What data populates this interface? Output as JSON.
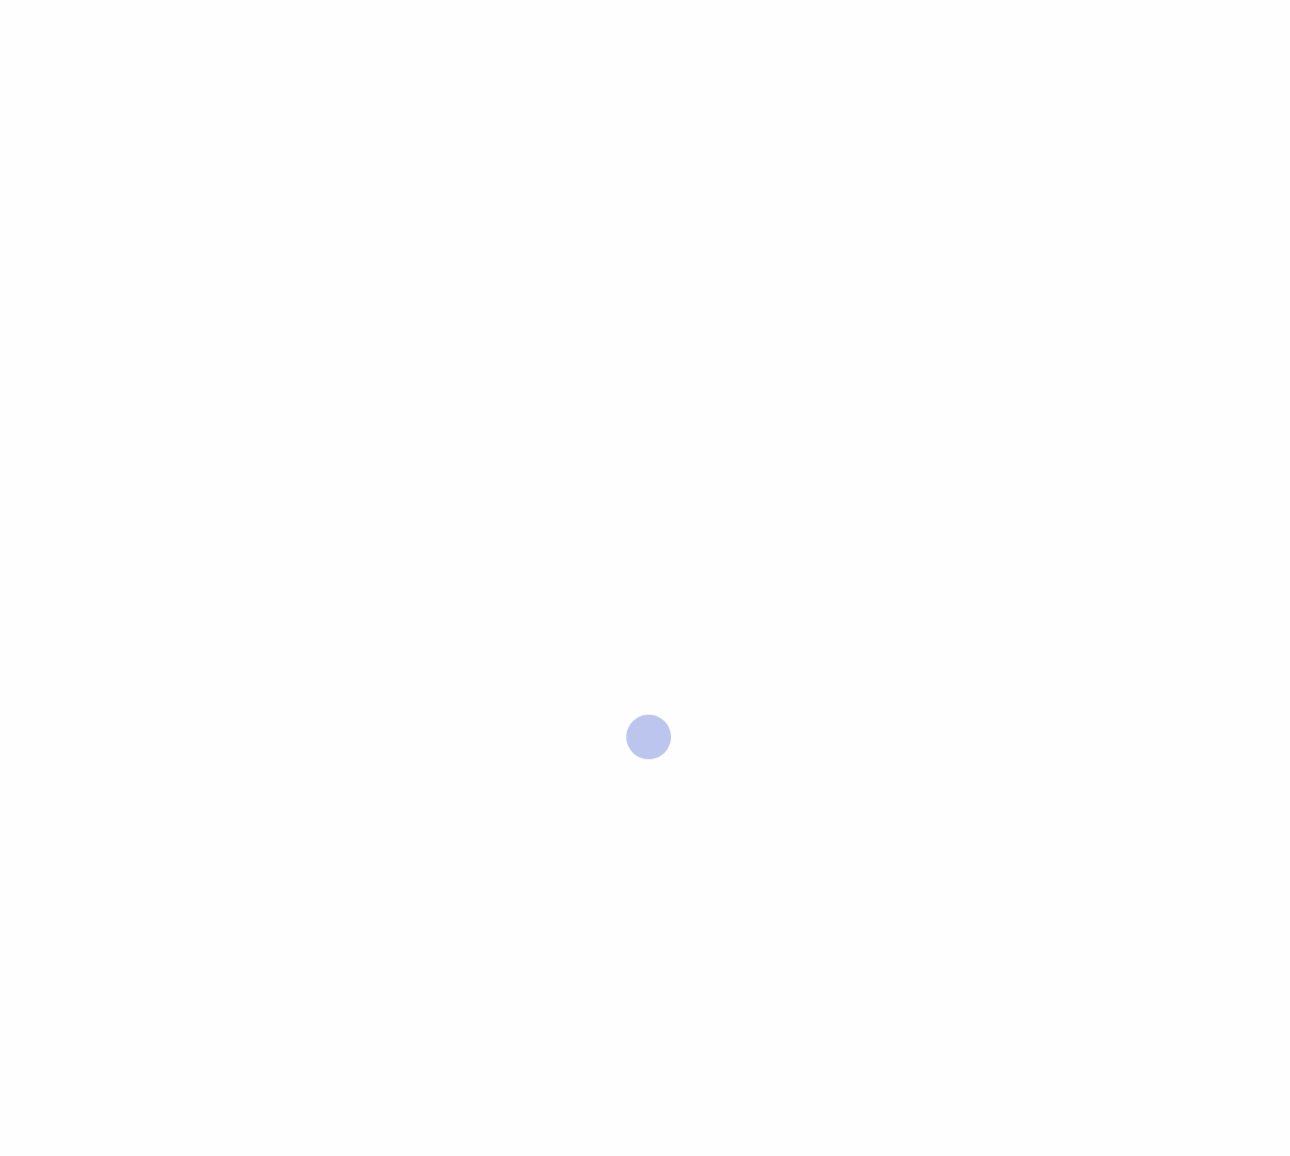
{
  "screen": {
    "background_color": "#fefefe"
  },
  "loading_indicator": {
    "icon": "loading-dot-icon",
    "color": "#bcc5ee"
  }
}
